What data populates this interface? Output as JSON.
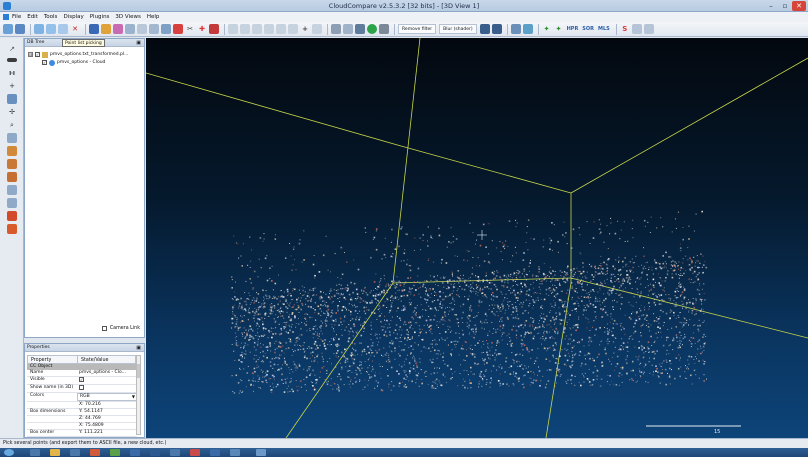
{
  "window": {
    "title": "CloudCompare v2.5.3.2 [32 bits] - [3D View 1]",
    "controls": {
      "minimize": "–",
      "maximize": "▫",
      "close": "✕"
    }
  },
  "menu": [
    "File",
    "Edit",
    "Tools",
    "Display",
    "Plugins",
    "3D Views",
    "Help"
  ],
  "toolbar": {
    "tooltip": "Point list picking",
    "remove_filter": "Remove filter",
    "blur_shader": "Blur (shader)",
    "hpr_label": "HPR",
    "sor_label": "SOR",
    "mls_label": "MLS"
  },
  "db_tree": {
    "title": "DB Tree",
    "pin": "▣",
    "items": [
      {
        "label": "pmvs_options.txt_transformed.pl...",
        "expander": "⊟",
        "checked": "✓"
      },
      {
        "label": "pmvs_options - Cloud",
        "checked": "✓"
      }
    ],
    "camera_link": "Camera Link"
  },
  "properties": {
    "title": "Properties",
    "pin": "▣",
    "headers": [
      "Property",
      "State/Value"
    ],
    "section": "CC Object",
    "rows": [
      {
        "k": "Name",
        "v": "pmvs_options - Clo..."
      },
      {
        "k": "Visible",
        "box": "✓"
      },
      {
        "k": "Show name (in 3D)",
        "box": ""
      },
      {
        "k": "Colors",
        "v": "RGB"
      },
      {
        "k": "",
        "v": "X: 70.216"
      },
      {
        "k": "Box dimensions",
        "v": "Y: 54.1147"
      },
      {
        "k": "",
        "v": "Z: 44.769"
      },
      {
        "k": "",
        "v": "X: 75.4809"
      },
      {
        "k": "Box center",
        "v": "Y: 111.221"
      }
    ]
  },
  "view3d": {
    "scale_label": "15"
  },
  "status": {
    "message": "Pick several points (and export them to ASCII file, a new cloud, etc.)"
  }
}
